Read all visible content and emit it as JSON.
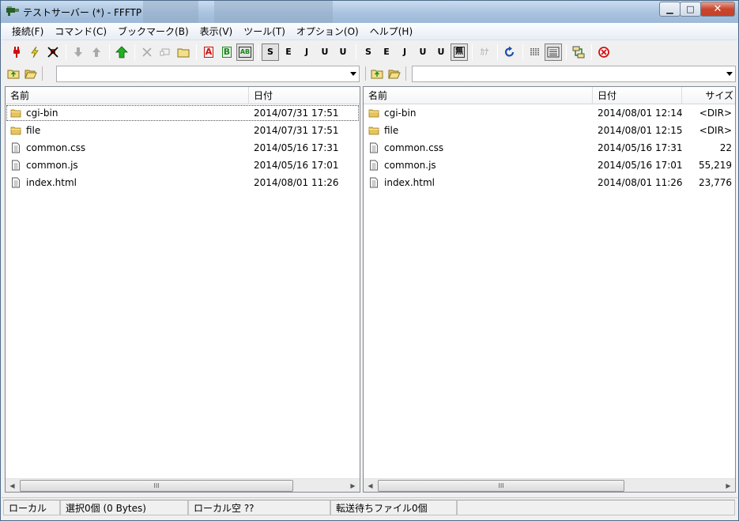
{
  "window": {
    "title": "テストサーバー (*) - FFFTP",
    "minimize": "▁",
    "maximize": "□",
    "close": "✕"
  },
  "menu": [
    "接続(F)",
    "コマンド(C)",
    "ブックマーク(B)",
    "表示(V)",
    "ツール(T)",
    "オプション(O)",
    "ヘルプ(H)"
  ],
  "toolbar": {
    "ascii_mode": "A",
    "binary_mode": "B",
    "auto_mode": "AB",
    "kanji_sjis_local": "S",
    "kanji_euc_local": "E",
    "kanji_jis_local": "J",
    "kanji_utf8n_local": "U",
    "kanji_utf8bom_local": "U",
    "kanji_sjis_remote": "S",
    "kanji_euc_remote": "E",
    "kanji_jis_remote": "J",
    "kanji_utf8n_remote": "U",
    "kanji_utf8bom_remote": "U",
    "no_convert": "無",
    "kana": "ｶﾅ"
  },
  "local": {
    "path": "",
    "columns": {
      "name": "名前",
      "date": "日付"
    },
    "files": [
      {
        "name": "cgi-bin",
        "date": "2014/07/31 17:51",
        "type": "folder"
      },
      {
        "name": "file",
        "date": "2014/07/31 17:51",
        "type": "folder"
      },
      {
        "name": "common.css",
        "date": "2014/05/16 17:31",
        "type": "file"
      },
      {
        "name": "common.js",
        "date": "2014/05/16 17:01",
        "type": "file"
      },
      {
        "name": "index.html",
        "date": "2014/08/01 11:26",
        "type": "file"
      }
    ]
  },
  "remote": {
    "path": "",
    "columns": {
      "name": "名前",
      "date": "日付",
      "size": "サイズ"
    },
    "files": [
      {
        "name": "cgi-bin",
        "date": "2014/08/01 12:14",
        "size": "<DIR>",
        "type": "folder"
      },
      {
        "name": "file",
        "date": "2014/08/01 12:15",
        "size": "<DIR>",
        "type": "folder"
      },
      {
        "name": "common.css",
        "date": "2014/05/16 17:31",
        "size": "22",
        "type": "file"
      },
      {
        "name": "common.js",
        "date": "2014/05/16 17:01",
        "size": "55,219",
        "type": "file"
      },
      {
        "name": "index.html",
        "date": "2014/08/01 11:26",
        "size": "23,776",
        "type": "file"
      }
    ]
  },
  "status": {
    "location": "ローカル",
    "selection": "選択0個 (0 Bytes)",
    "free": "ローカル空 ??",
    "queue": "転送待ちファイル0個"
  },
  "scroll_thumb": "III",
  "colors": {
    "accent_red": "#d01010",
    "folder": "#e8c45a",
    "green": "#1a8a1a"
  }
}
